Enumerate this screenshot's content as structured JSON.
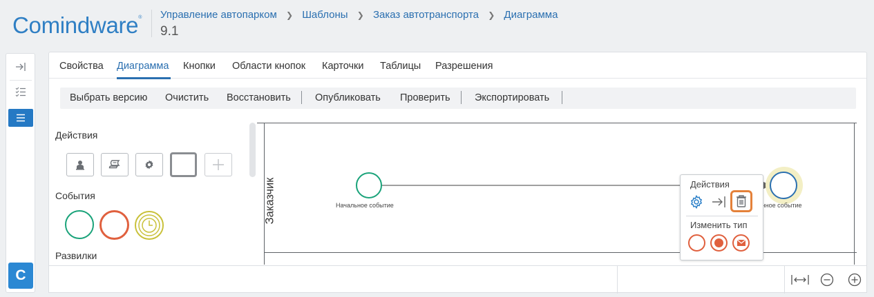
{
  "header": {
    "logo": "Comindware",
    "logo_mark": "®",
    "breadcrumb": [
      "Управление автопарком",
      "Шаблоны",
      "Заказ автотранспорта",
      "Диаграмма"
    ],
    "version": "9.1"
  },
  "rail": {
    "items": [
      {
        "icon": "collapse-right-icon"
      },
      {
        "icon": "checklist-icon"
      },
      {
        "icon": "list-icon",
        "active": true
      }
    ],
    "brand": "C"
  },
  "tabs": [
    {
      "label": "Свойства"
    },
    {
      "label": "Диаграмма",
      "active": true
    },
    {
      "label": "Кнопки"
    },
    {
      "label": "Области кнопок"
    },
    {
      "label": "Карточки"
    },
    {
      "label": "Таблицы"
    },
    {
      "label": "Разрешения"
    }
  ],
  "toolbar": {
    "select_version": "Выбрать версию",
    "clear": "Очистить",
    "restore": "Восстановить",
    "publish": "Опубликовать",
    "validate": "Проверить",
    "export": "Экспортировать"
  },
  "palette": {
    "actions_title": "Действия",
    "events_title": "События",
    "gateways_title": "Развилки"
  },
  "diagram": {
    "lane_label": "Заказчик",
    "start_event_label": "Начальное событие",
    "end_event_label": "Конечное событие"
  },
  "popup": {
    "actions_title": "Действия",
    "change_type_title": "Изменить тип"
  },
  "colors": {
    "accent": "#2a6fb0",
    "start_event": "#1aa37a",
    "end_event": "#e0603e",
    "timer_event": "#c9c13a",
    "end_event_selected": "#2a6fb0",
    "highlight": "#e4813a"
  }
}
